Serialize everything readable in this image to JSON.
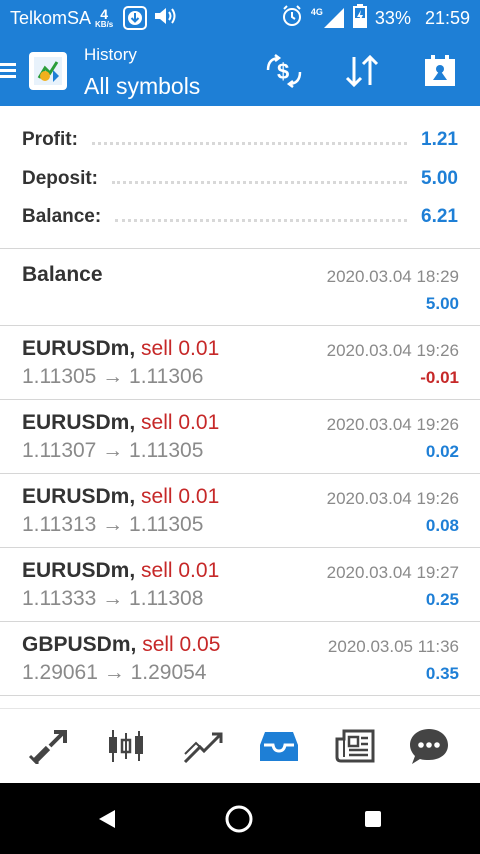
{
  "status_bar": {
    "carrier": "TelkomSA",
    "speed_value": "4",
    "speed_unit": "KB/s",
    "network": "4G",
    "battery": "33%",
    "time": "21:59"
  },
  "app_bar": {
    "subtitle": "History",
    "title": "All symbols"
  },
  "summary": [
    {
      "label": "Profit:",
      "value": "1.21"
    },
    {
      "label": "Deposit:",
      "value": "5.00"
    },
    {
      "label": "Balance:",
      "value": "6.21"
    }
  ],
  "balance_entry": {
    "label": "Balance",
    "time": "2020.03.04 18:29",
    "amount": "5.00"
  },
  "trades": [
    {
      "symbol": "EURUSDm,",
      "action": "sell 0.01",
      "prices": "1.11305 → 1.11306",
      "time": "2020.03.04 19:26",
      "profit": "-0.01",
      "negative": true
    },
    {
      "symbol": "EURUSDm,",
      "action": "sell 0.01",
      "prices": "1.11307 → 1.11305",
      "time": "2020.03.04 19:26",
      "profit": "0.02",
      "negative": false
    },
    {
      "symbol": "EURUSDm,",
      "action": "sell 0.01",
      "prices": "1.11313 → 1.11305",
      "time": "2020.03.04 19:26",
      "profit": "0.08",
      "negative": false
    },
    {
      "symbol": "EURUSDm,",
      "action": "sell 0.01",
      "prices": "1.11333 → 1.11308",
      "time": "2020.03.04 19:27",
      "profit": "0.25",
      "negative": false
    },
    {
      "symbol": "GBPUSDm,",
      "action": "sell 0.05",
      "prices": "1.29061 → 1.29054",
      "time": "2020.03.05 11:36",
      "profit": "0.35",
      "negative": false
    }
  ],
  "colors": {
    "accent": "#1e7fd6",
    "negative": "#c62828",
    "muted": "#8a8a8a",
    "text": "#333333"
  },
  "tabs": [
    "quotes-icon",
    "chart-icon",
    "trade-icon",
    "history-icon",
    "news-icon",
    "chat-icon"
  ],
  "active_tab": "history-icon"
}
